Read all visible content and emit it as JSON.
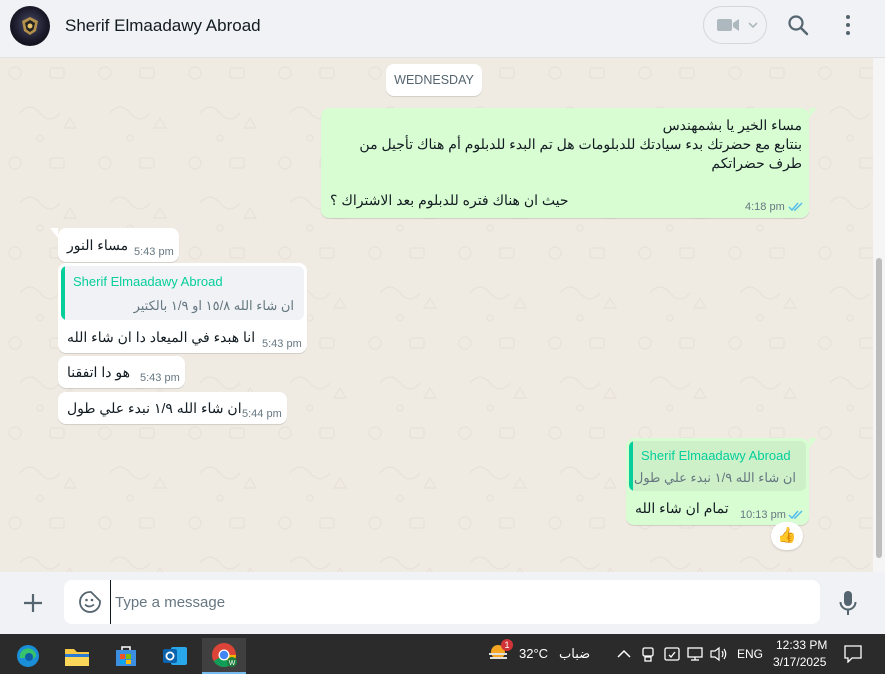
{
  "header": {
    "chat_name": "Sherif Elmaadawy Abroad"
  },
  "chat": {
    "day_label": "WEDNESDAY",
    "messages": [
      {
        "direction": "out",
        "lines": [
          "مساء الخير يا بشمهندس",
          "بنتابع مع حضرتك بدء سيادتك للدبلومات هل تم البدء للدبلوم أم هناك تأجيل من",
          "طرف حضراتكم",
          "",
          "حيث ان هناك فتره للدبلوم بعد الاشتراك ؟"
        ],
        "time": "4:18 pm",
        "status": "read"
      },
      {
        "direction": "in",
        "text": "مساء النور",
        "time": "5:43 pm"
      },
      {
        "direction": "in",
        "quote_author": "Sherif Elmaadawy Abroad",
        "quote_text": "ان شاء الله ١٥/٨ او ١/٩ بالكتير",
        "text": "انا هبدء في الميعاد دا ان شاء الله",
        "time": "5:43 pm"
      },
      {
        "direction": "in",
        "text": "هو دا اتفقنا",
        "time": "5:43 pm"
      },
      {
        "direction": "in",
        "text": "ان شاء الله ١/٩ نبدء علي طول",
        "time": "5:44 pm"
      },
      {
        "direction": "out",
        "quote_author": "Sherif Elmaadawy Abroad",
        "quote_text": "ان شاء الله ١/٩ نبدء علي طول",
        "text": "تمام ان شاء الله",
        "time": "10:13 pm",
        "status": "read",
        "reaction": "👍"
      }
    ]
  },
  "composer": {
    "placeholder": "Type a message"
  },
  "taskbar": {
    "apps": [
      "edge-icon",
      "file-explorer-icon",
      "store-icon",
      "outlook-icon",
      "chrome-icon"
    ],
    "weather_badge": "1",
    "temperature": "32°C",
    "weather_condition": "ضباب",
    "language": "ENG",
    "time": "12:33 PM",
    "date": "3/17/2025"
  },
  "colors": {
    "outgoing_bubble": "#d9fdd3",
    "incoming_bubble": "#ffffff",
    "chat_background": "#efeae2",
    "accent_green": "#06cf9c",
    "read_ticks": "#53bdeb"
  }
}
